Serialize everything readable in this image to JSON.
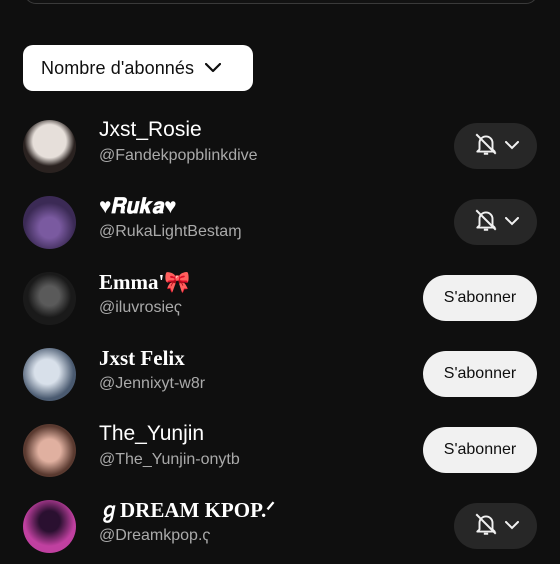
{
  "sort": {
    "label": "Nombre d'abonnés"
  },
  "channels": [
    {
      "name": "Jxst_Rosie",
      "handle": "@Fandekpopblinkdive",
      "action": "bell",
      "avatar_colors": [
        "#d9d4d0",
        "#2a2220"
      ]
    },
    {
      "name": "♥𝑹𝒖𝒌𝒂♥",
      "handle": "@RukaLightBestaɱ",
      "action": "bell",
      "avatar_colors": [
        "#3b2a55",
        "#7a5aa0"
      ]
    },
    {
      "name": "Emma'🎀",
      "handle": "@iluvrosieҁ",
      "action": "subscribe",
      "avatar_colors": [
        "#1a1a1a",
        "#5a5a5a"
      ]
    },
    {
      "name": "Jxst Felix",
      "handle": "@Jennixyt-w8r",
      "action": "subscribe",
      "avatar_colors": [
        "#b8c8d8",
        "#4a5a70"
      ]
    },
    {
      "name": "The_Yunjin",
      "handle": "@The_Yunjin-onytb",
      "action": "subscribe",
      "avatar_colors": [
        "#c89080",
        "#5a3a30"
      ]
    },
    {
      "name": "ℊDREAM KPOP.ᐟ",
      "handle": "@Dreamkpop.ҁ",
      "action": "bell",
      "avatar_colors": [
        "#c040a0",
        "#2a1030"
      ]
    }
  ],
  "subscribe_label": "S'abonner",
  "icons": {
    "sort_chevron": "chevron-down-icon",
    "bell": "bell-off-icon",
    "bell_chevron": "chevron-down-icon"
  }
}
